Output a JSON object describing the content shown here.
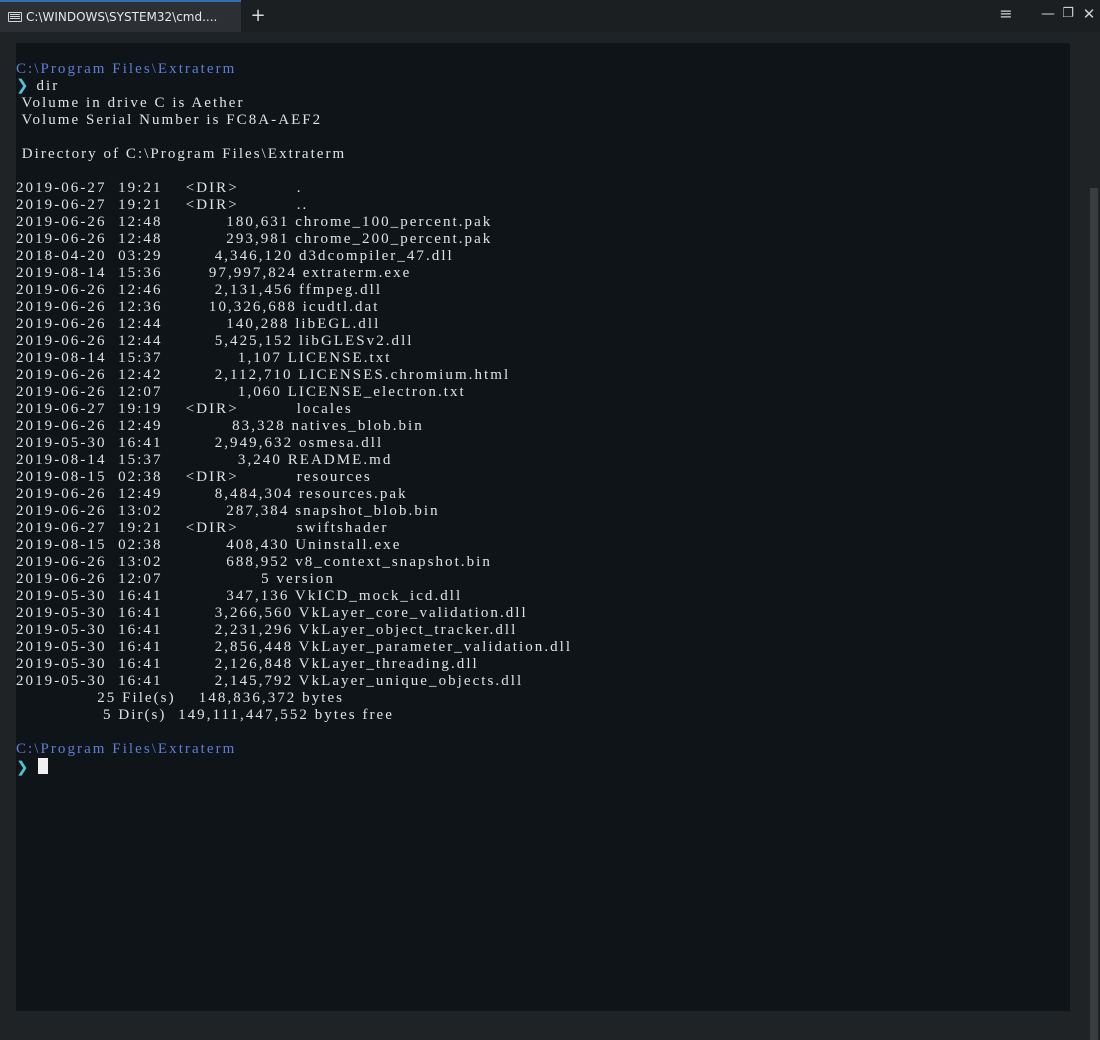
{
  "tab": {
    "title": "C:\\WINDOWS\\SYSTEM32\\cmd...."
  },
  "controls": {
    "new_tab": "+",
    "menu": "≡",
    "minimize": "—",
    "maximize": "❐",
    "close": "✕"
  },
  "prompt_symbol": "❯",
  "session": {
    "path": "C:\\Program Files\\Extraterm",
    "command": "dir",
    "volume_line": " Volume in drive C is Aether",
    "serial_line": " Volume Serial Number is FC8A-AEF2",
    "directory_line": " Directory of C:\\Program Files\\Extraterm",
    "entries": [
      "2019-06-27  19:21    <DIR>          .",
      "2019-06-27  19:21    <DIR>          ..",
      "2019-06-26  12:48           180,631 chrome_100_percent.pak",
      "2019-06-26  12:48           293,981 chrome_200_percent.pak",
      "2018-04-20  03:29         4,346,120 d3dcompiler_47.dll",
      "2019-08-14  15:36        97,997,824 extraterm.exe",
      "2019-06-26  12:46         2,131,456 ffmpeg.dll",
      "2019-06-26  12:36        10,326,688 icudtl.dat",
      "2019-06-26  12:44           140,288 libEGL.dll",
      "2019-06-26  12:44         5,425,152 libGLESv2.dll",
      "2019-08-14  15:37             1,107 LICENSE.txt",
      "2019-06-26  12:42         2,112,710 LICENSES.chromium.html",
      "2019-06-26  12:07             1,060 LICENSE_electron.txt",
      "2019-06-27  19:19    <DIR>          locales",
      "2019-06-26  12:49            83,328 natives_blob.bin",
      "2019-05-30  16:41         2,949,632 osmesa.dll",
      "2019-08-14  15:37             3,240 README.md",
      "2019-08-15  02:38    <DIR>          resources",
      "2019-06-26  12:49         8,484,304 resources.pak",
      "2019-06-26  13:02           287,384 snapshot_blob.bin",
      "2019-06-27  19:21    <DIR>          swiftshader",
      "2019-08-15  02:38           408,430 Uninstall.exe",
      "2019-06-26  13:02           688,952 v8_context_snapshot.bin",
      "2019-06-26  12:07                 5 version",
      "2019-05-30  16:41           347,136 VkICD_mock_icd.dll",
      "2019-05-30  16:41         3,266,560 VkLayer_core_validation.dll",
      "2019-05-30  16:41         2,231,296 VkLayer_object_tracker.dll",
      "2019-05-30  16:41         2,856,448 VkLayer_parameter_validation.dll",
      "2019-05-30  16:41         2,126,848 VkLayer_threading.dll",
      "2019-05-30  16:41         2,145,792 VkLayer_unique_objects.dll"
    ],
    "files_summary": "              25 File(s)    148,836,372 bytes",
    "dirs_summary": "               5 Dir(s)  149,111,447,552 bytes free"
  },
  "colors": {
    "path": "#5b7fd6",
    "prompt": "#4fc4d6",
    "text": "#e2e2e2",
    "background": "#0f1418",
    "tab_accent": "#2f6fb6"
  }
}
